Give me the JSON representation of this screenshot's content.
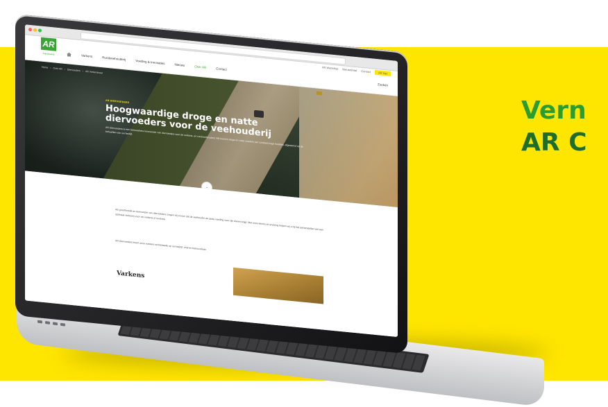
{
  "headline": {
    "line1": "Vern",
    "line2": "AR C"
  },
  "browser": {
    "colors": {
      "close": "#ff5f57",
      "min": "#febc2e",
      "max": "#28c840"
    }
  },
  "site": {
    "top_links": [
      "AR Webshop",
      "Nieuwsbrief",
      "Contact"
    ],
    "cta": "AR Net",
    "logo": {
      "mark": "AR",
      "sub": "Juijntsbedrijf"
    },
    "nav": [
      "Varkens",
      "Rundveehouderij",
      "Voeding & Innovaties",
      "Nieuws",
      "Over AR",
      "Contact"
    ],
    "search": "Zoeken"
  },
  "hero": {
    "breadcrumb": [
      "Home",
      "Over AR",
      "Diervoeders",
      "AR Varkensvoer"
    ],
    "tag": "AR DIERVOEDERS",
    "title": "Hoogwaardige droge en natte diervoeders voor de veehouderij",
    "text": "AR Diervoeders is een betrouwbare leverancier van diervoeders voor de varkens- en rundveehouderij. Wij leveren droge en natte voeders van constant hoge kwaliteit, afgestemd op de behoeften van uw bedrijf."
  },
  "content": {
    "para1": "Als groothandel en leverancier van diervoeders zorgen wij ervoor dat de veehouder de juiste voeding voor zijn dieren krijgt. Met onze kennis en ervaring helpen wij u bij het samenstellen van een optimaal rantsoen voor uw varkens of rundvee.",
    "para2": "AR Diervoeders levert onze voeders rechtstreeks op uw bedrijf, snel en betrouwbaar.",
    "section_title": "Varkens"
  },
  "colors": {
    "brand_green": "#3aa535",
    "yellow": "#ffe600",
    "headline_dark": "#1f6d2a"
  }
}
